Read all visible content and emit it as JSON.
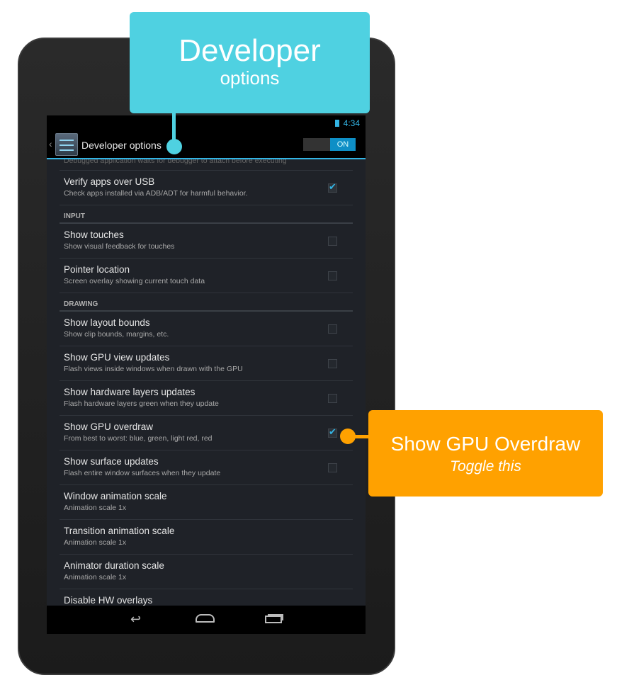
{
  "callouts": {
    "developer": {
      "line1": "Developer",
      "line2": "options"
    },
    "overdraw": {
      "line1": "Show GPU Overdraw",
      "line2": "Toggle this"
    }
  },
  "status": {
    "time": "4:34"
  },
  "actionbar": {
    "title": "Developer options",
    "switch_label": "ON"
  },
  "partial_top": "Debugged application waits for debugger to attach before executing",
  "items": [
    {
      "title": "Verify apps over USB",
      "summary": "Check apps installed via ADB/ADT for harmful behavior.",
      "checked": true
    },
    {
      "header": "INPUT"
    },
    {
      "title": "Show touches",
      "summary": "Show visual feedback for touches",
      "checked": false
    },
    {
      "title": "Pointer location",
      "summary": "Screen overlay showing current touch data",
      "checked": false
    },
    {
      "header": "DRAWING"
    },
    {
      "title": "Show layout bounds",
      "summary": "Show clip bounds, margins, etc.",
      "checked": false
    },
    {
      "title": "Show GPU view updates",
      "summary": "Flash views inside windows when drawn with the GPU",
      "checked": false
    },
    {
      "title": "Show hardware layers updates",
      "summary": "Flash hardware layers green when they update",
      "checked": false
    },
    {
      "title": "Show GPU overdraw",
      "summary": "From best to worst: blue, green, light red, red",
      "checked": true
    },
    {
      "title": "Show surface updates",
      "summary": "Flash entire window surfaces when they update",
      "checked": false
    },
    {
      "title": "Window animation scale",
      "summary": "Animation scale 1x"
    },
    {
      "title": "Transition animation scale",
      "summary": "Animation scale 1x"
    },
    {
      "title": "Animator duration scale",
      "summary": "Animation scale 1x"
    },
    {
      "title": "Disable HW overlays",
      "summary": ""
    }
  ],
  "colors": {
    "accent": "#33b5e5",
    "callout_cyan": "#4fd1e1",
    "callout_orange": "#ffa100"
  }
}
